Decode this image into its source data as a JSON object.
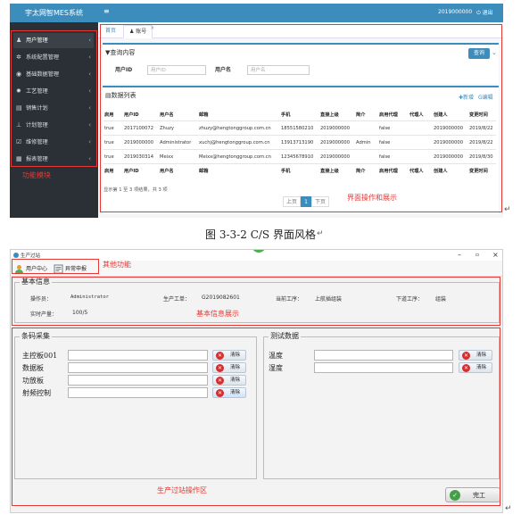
{
  "web": {
    "brand": "宇太网智MES系统",
    "header_user": "2019000000",
    "logout": "退出",
    "menu": [
      {
        "label": "用户管理",
        "icon": "user-icon"
      },
      {
        "label": "系统配置管理",
        "icon": "gear-icon"
      },
      {
        "label": "基础数据管理",
        "icon": "database-icon"
      },
      {
        "label": "工艺管理",
        "icon": "cog-icon"
      },
      {
        "label": "销售计划",
        "icon": "document-icon"
      },
      {
        "label": "计划管理",
        "icon": "plan-icon"
      },
      {
        "label": "维修管理",
        "icon": "wrench-icon"
      },
      {
        "label": "报表管理",
        "icon": "report-icon"
      }
    ],
    "tabs": [
      "首页",
      "账号"
    ],
    "query": {
      "title": "查询内容",
      "search_button": "查询",
      "user_id_label": "用户ID",
      "user_id_placeholder": "用户ID",
      "username_label": "用户名",
      "username_placeholder": "用户名"
    },
    "list": {
      "title": "数据列表",
      "add": "新增",
      "edit": "编辑",
      "columns": [
        "启用",
        "用户ID",
        "用户名",
        "邮箱",
        "手机",
        "直接上级",
        "简介",
        "启用代理",
        "代理人",
        "创建人",
        "变更时间"
      ],
      "rows": [
        [
          "true",
          "2017100072",
          "Zhuzy",
          "zhuzy@hengtonggroup.com.cn",
          "18551580210",
          "2019000000",
          "",
          "false",
          "",
          "2019000000",
          "2019/8/22"
        ],
        [
          "true",
          "2019000000",
          "Administrator",
          "xuchj@hengtonggroup.com.cn",
          "13913713190",
          "2019000000",
          "Admin",
          "false",
          "",
          "2019000000",
          "2019/8/22"
        ],
        [
          "true",
          "2019030314",
          "Meixx",
          "Meixx@hengtonggroup.com.cn",
          "12345678910",
          "2019000000",
          "",
          "false",
          "",
          "2019000000",
          "2019/8/30"
        ]
      ],
      "footer_text": "显示第 1 至 3 项结果，共 3 项",
      "prev": "上页",
      "page": "1",
      "next": "下页"
    },
    "annotations": {
      "menu_module": "功能模块",
      "interface_ops": "界面操作和展示"
    }
  },
  "caption": "图 3-3-2 C/S 界面风格",
  "desktop": {
    "window_title": "生产过站",
    "badge": "34",
    "toolbar": [
      {
        "label": "用户中心",
        "icon": "user-center-icon"
      },
      {
        "label": "异常申报",
        "icon": "report-exception-icon"
      }
    ],
    "basic_info": {
      "title": "基本信息",
      "operator_label": "操作员：",
      "operator_value": "Administrator",
      "work_order_label": "生产工单：",
      "work_order_value": "G2019082601",
      "current_process_label": "当前工序：",
      "current_process_value": "上航插组装",
      "next_process_label": "下道工序：",
      "next_process_value": "组装",
      "yield_label": "实时产量：",
      "yield_value": "100/5"
    },
    "barcode": {
      "title": "条码采集",
      "fields": [
        "主控板001",
        "数据板",
        "功放板",
        "射频控制"
      ],
      "clear": "清除"
    },
    "test": {
      "title": "测试数据",
      "fields": [
        "温度",
        "湿度"
      ],
      "clear": "清除"
    },
    "done": "完工",
    "annotations": {
      "other_functions": "其他功能",
      "basic_info_display": "基本信息展示",
      "operation_area": "生产过站操作区"
    }
  }
}
